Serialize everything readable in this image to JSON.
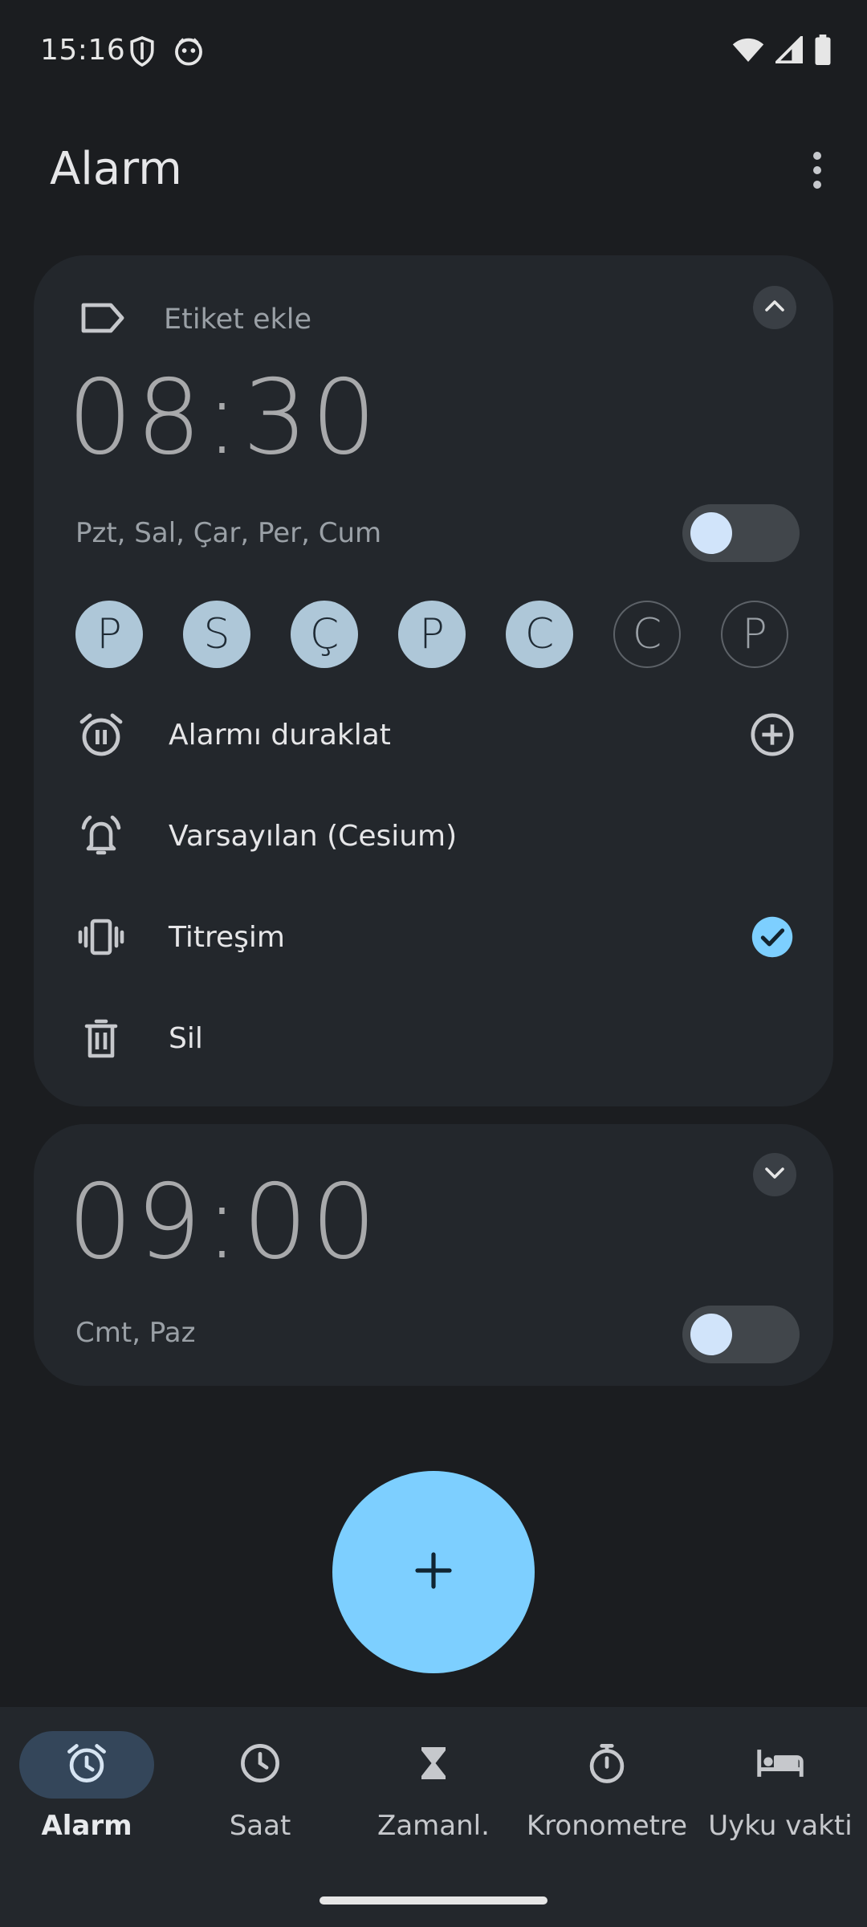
{
  "status_bar": {
    "time": "15:16",
    "icons_left": [
      "shield-icon",
      "face-icon"
    ],
    "icons_right": [
      "wifi-icon",
      "signal-icon",
      "battery-icon"
    ]
  },
  "app_bar": {
    "title": "Alarm",
    "overflow_icon": "more-vert-icon"
  },
  "alarms": [
    {
      "label_placeholder": "Etiket ekle",
      "time": "08:30",
      "days_summary": "Pzt, Sal, Çar, Per, Cum",
      "enabled": false,
      "expanded": true,
      "days": [
        {
          "letter": "P",
          "selected": true
        },
        {
          "letter": "S",
          "selected": true
        },
        {
          "letter": "Ç",
          "selected": true
        },
        {
          "letter": "P",
          "selected": true
        },
        {
          "letter": "C",
          "selected": true
        },
        {
          "letter": "C",
          "selected": false
        },
        {
          "letter": "P",
          "selected": false
        }
      ],
      "options": {
        "snooze": "Alarmı duraklat",
        "ringtone": "Varsayılan (Cesium)",
        "vibrate": "Titreşim",
        "vibrate_checked": true,
        "delete": "Sil"
      }
    },
    {
      "time": "09:00",
      "days_summary": "Cmt, Paz",
      "enabled": false,
      "expanded": false
    }
  ],
  "fab": {
    "icon": "plus-icon"
  },
  "bottom_nav": [
    {
      "label": "Alarm",
      "icon": "alarm-icon",
      "active": true
    },
    {
      "label": "Saat",
      "icon": "clock-icon",
      "active": false
    },
    {
      "label": "Zamanl.",
      "icon": "hourglass-icon",
      "active": false
    },
    {
      "label": "Kronometre",
      "icon": "stopwatch-icon",
      "active": false
    },
    {
      "label": "Uyku vakti",
      "icon": "bed-icon",
      "active": false
    }
  ],
  "colors": {
    "background": "#1b1d20",
    "card": "#23272c",
    "accent": "#7dcfff",
    "day_selected": "#aec7d8",
    "check": "#7dcfff"
  }
}
